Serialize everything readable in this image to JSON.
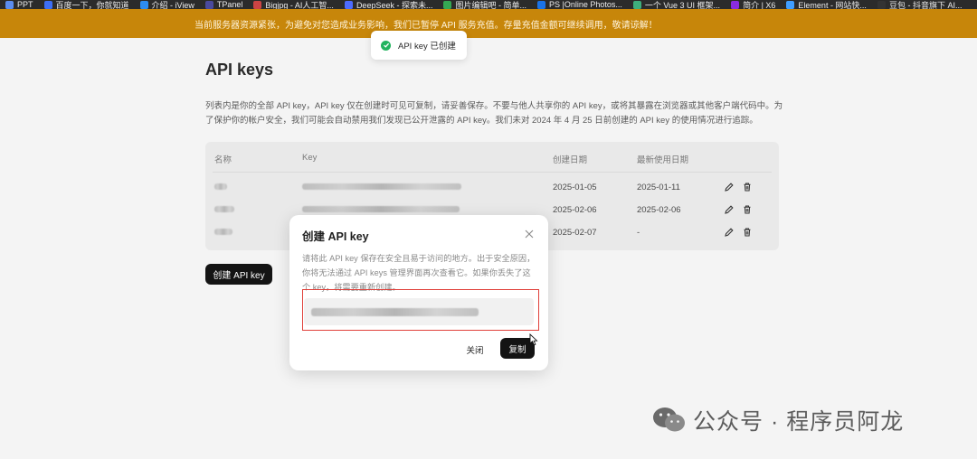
{
  "bookmarks": [
    {
      "label": "PPT",
      "color": "#5c8df0"
    },
    {
      "label": "百度一下，你就知道",
      "color": "#3d6ef5"
    },
    {
      "label": "介绍 - iView",
      "color": "#2d8cf0"
    },
    {
      "label": "TPanel",
      "color": "#4a4a9e"
    },
    {
      "label": "Bigjpg - AI人工智...",
      "color": "#c44"
    },
    {
      "label": "DeepSeek - 探索未...",
      "color": "#4d6bfe"
    },
    {
      "label": "图片编辑吧 - 简单...",
      "color": "#35a853"
    },
    {
      "label": "PS |Online Photos...",
      "color": "#1a73e8"
    },
    {
      "label": "一个 Vue 3 UI 框架...",
      "color": "#3eaf7c"
    },
    {
      "label": "简介 | X6",
      "color": "#8a2be2"
    },
    {
      "label": "Element - 网站快...",
      "color": "#409eff"
    },
    {
      "label": "豆包 - 抖音旗下 AI...",
      "color": "#333"
    }
  ],
  "banner": {
    "text": "当前服务器资源紧张，为避免对您造成业务影响，我们已暂停 API 服务充值。存量充值金额可继续调用，敬请谅解！"
  },
  "toast": {
    "text": "API key 已创建"
  },
  "page": {
    "title": "API keys",
    "description": "列表内是你的全部 API key，API key 仅在创建时可见可复制，请妥善保存。不要与他人共享你的 API key，或将其暴露在浏览器或其他客户端代码中。为了保护你的帐户安全，我们可能会自动禁用我们发现已公开泄露的 API key。我们未对 2024 年 4 月 25 日前创建的 API key 的使用情况进行追踪。",
    "table": {
      "headers": [
        "名称",
        "Key",
        "创建日期",
        "最新使用日期"
      ],
      "rows": [
        {
          "created": "2025-01-05",
          "last_used": "2025-01-11"
        },
        {
          "created": "2025-02-06",
          "last_used": "2025-02-06"
        },
        {
          "created": "2025-02-07",
          "last_used": "-"
        }
      ]
    },
    "create_button": "创建 API key"
  },
  "modal": {
    "title": "创建 API key",
    "text": "请将此 API key 保存在安全且易于访问的地方。出于安全原因，你将无法通过 API keys 管理界面再次查看它。如果你丢失了这个 key，将需要重新创建。",
    "close_label": "关闭",
    "copy_label": "复制"
  },
  "watermark": {
    "text": "公众号 · 程序员阿龙"
  },
  "colors": {
    "banner": "#c7860a",
    "success": "#22b35e",
    "highlight": "#e0403a",
    "primary_button": "#141414"
  }
}
